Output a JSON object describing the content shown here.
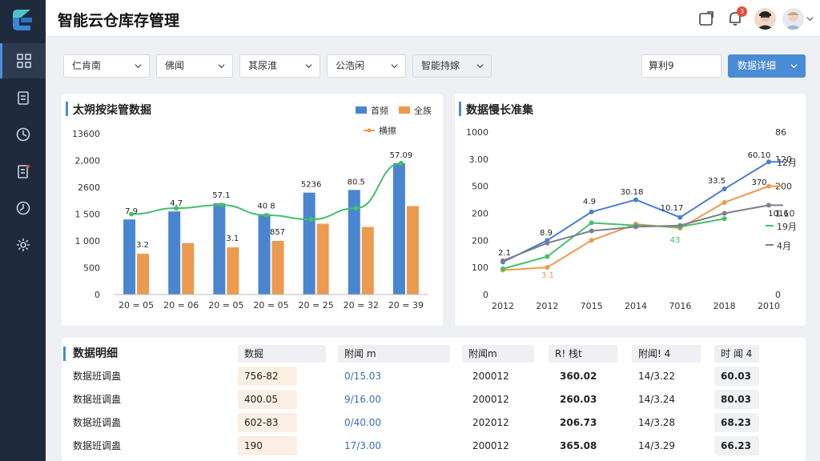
{
  "app": {
    "title": "智能云仓库存管理"
  },
  "header": {
    "notification_count": "3"
  },
  "filters": [
    {
      "label": "仁肯南"
    },
    {
      "label": "佛闻"
    },
    {
      "label": "其尿淮"
    },
    {
      "label": "公浩闲"
    },
    {
      "label": "智能持嫁"
    }
  ],
  "search": {
    "value": "算利9"
  },
  "primary_button": {
    "label": "数据详细"
  },
  "left_chart": {
    "title": "太朔按柒管数掘",
    "legend": [
      "首频",
      "全族",
      "横擦"
    ],
    "colors": {
      "blue": "#4a86cf",
      "orange": "#ec9a4f",
      "green": "#43c06b"
    }
  },
  "right_chart": {
    "title": "数据慢长准集",
    "colors": {
      "blue": "#4a7fd0",
      "orange": "#ec9a4f",
      "green": "#43c06b",
      "gray": "#7d7f8c"
    }
  },
  "chart_data": [
    {
      "type": "bar",
      "title": "太朔按柒管数掘",
      "categories": [
        "20 = 05",
        "20 = 06",
        "20 = 05",
        "20 = 05",
        "20 = 25",
        "20 = 32",
        "20 = 39"
      ],
      "y_ticks": [
        "13600",
        "2,000",
        "2600",
        "1 500",
        "1 000",
        "500",
        "0"
      ],
      "series": [
        {
          "name": "首频",
          "values": [
            1400,
            1550,
            1700,
            1500,
            1900,
            1950,
            2450
          ]
        },
        {
          "name": "全族",
          "values": [
            760,
            960,
            880,
            1000,
            1320,
            1260,
            1650
          ]
        },
        {
          "name": "横擦",
          "values": [
            1500,
            1610,
            1670,
            1480,
            1400,
            1610,
            2450
          ]
        }
      ],
      "bar_labels": [
        "7.9",
        "4.7",
        "57.1",
        "40 8",
        "5236",
        "80.5",
        "57.09"
      ],
      "orange_labels": [
        "3.2",
        "",
        "3.1",
        "857",
        "",
        "",
        ""
      ],
      "ylim": [
        0,
        3000
      ]
    },
    {
      "type": "line",
      "title": "数据慢长准集",
      "x_ticks": [
        "2012",
        "2012",
        "7015",
        "2014",
        "7016",
        "2018",
        "2010"
      ],
      "y_ticks_left": [
        "1000",
        "3.00",
        "500",
        "200",
        "200",
        "100",
        "0"
      ],
      "y_ticks_right": [
        "86",
        "120",
        "200",
        "1.10",
        "",
        "",
        "0"
      ],
      "series": [
        {
          "name": "",
          "values": [
            120,
            200,
            305,
            350,
            285,
            390,
            490,
            490
          ]
        },
        {
          "name": "",
          "values": [
            90,
            100,
            200,
            260,
            245,
            340,
            400,
            400
          ]
        },
        {
          "name": "",
          "values": [
            95,
            140,
            265,
            255,
            250,
            280
          ]
        },
        {
          "name": "",
          "values": [
            125,
            190,
            235,
            250,
            255,
            300,
            330,
            330
          ]
        }
      ],
      "point_labels": [
        "2.1",
        "8.9",
        "4.9",
        "30.18",
        "10.17",
        "33.5",
        "60.10",
        "370",
        "1016",
        "3.1",
        "43"
      ],
      "side_labels": [
        "12月",
        "200",
        "1.10",
        "19月",
        "4月"
      ],
      "ylim": [
        0,
        600
      ]
    }
  ],
  "table": {
    "title": "数据明细",
    "headers": [
      "数掘",
      "附闻 m",
      "附闻m",
      "R! 栈t",
      "附闻! 4",
      "时 闻 4"
    ],
    "rows": [
      {
        "name": "数据班调蛊",
        "c1": "756-82",
        "c2": "0/15.03",
        "c3": "200012",
        "c4": "360.02",
        "c5": "14/3.22",
        "c6": "60.03"
      },
      {
        "name": "数据班调蛊",
        "c1": "400.05",
        "c2": "9/16.00",
        "c3": "200012",
        "c4": "260.03",
        "c5": "14/3.24",
        "c6": "80.03"
      },
      {
        "name": "数据班调蛊",
        "c1": "602-83",
        "c2": "0/40.00",
        "c3": "202012",
        "c4": "206.73",
        "c5": "14/3.28",
        "c6": "68.23"
      },
      {
        "name": "数据班调蛊",
        "c1": "190",
        "c2": "17/3.00",
        "c3": "200012",
        "c4": "365.08",
        "c5": "14/3.29",
        "c6": "66.23"
      }
    ]
  }
}
